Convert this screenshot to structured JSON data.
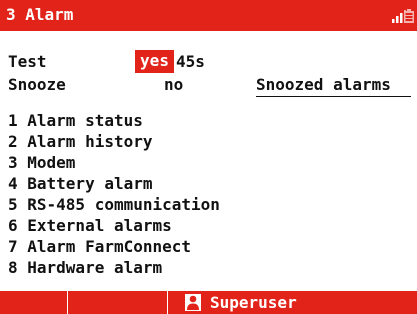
{
  "titlebar": {
    "title": "3 Alarm",
    "signal_icon": "signal-bars-icon",
    "battery_icon": "battery-icon"
  },
  "settings": {
    "test_label": "Test",
    "test_value": "yes",
    "test_duration": "45s",
    "snooze_label": "Snooze",
    "snooze_value": "no",
    "snoozed_link": "Snoozed alarms"
  },
  "menu": {
    "items": [
      {
        "label": "1 Alarm status"
      },
      {
        "label": "2 Alarm history"
      },
      {
        "label": "3 Modem"
      },
      {
        "label": "4 Battery alarm"
      },
      {
        "label": "5 RS-485 communication"
      },
      {
        "label": "6 External alarms"
      },
      {
        "label": "7 Alarm FarmConnect"
      },
      {
        "label": "8 Hardware alarm"
      }
    ]
  },
  "footer": {
    "user_icon": "user-icon",
    "user_label": "Superuser"
  },
  "colors": {
    "accent": "#e2231a",
    "text": "#111111",
    "background": "#ffffff"
  }
}
